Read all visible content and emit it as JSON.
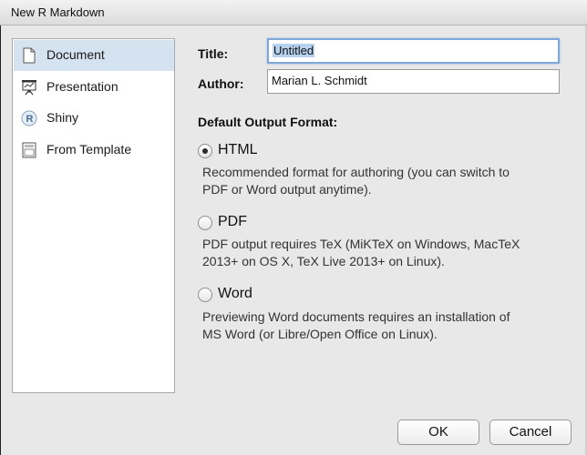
{
  "window": {
    "title": "New R Markdown"
  },
  "sidebar": {
    "items": [
      {
        "label": "Document",
        "icon": "document-icon",
        "selected": true
      },
      {
        "label": "Presentation",
        "icon": "presentation-icon",
        "selected": false
      },
      {
        "label": "Shiny",
        "icon": "shiny-r-icon",
        "selected": false
      },
      {
        "label": "From Template",
        "icon": "template-icon",
        "selected": false
      }
    ]
  },
  "form": {
    "title_label": "Title:",
    "title_value": "Untitled",
    "author_label": "Author:",
    "author_value": "Marian L. Schmidt",
    "output_heading": "Default Output Format:"
  },
  "formats": [
    {
      "label": "HTML",
      "checked": true,
      "description_line1": "Recommended format for authoring (you can switch to",
      "description_line2": "PDF or Word output anytime)."
    },
    {
      "label": "PDF",
      "checked": false,
      "description_line1": "PDF output requires TeX (MiKTeX on Windows, MacTeX",
      "description_line2": "2013+ on OS X, TeX Live 2013+ on Linux)."
    },
    {
      "label": "Word",
      "checked": false,
      "description_line1": "Previewing Word documents requires an installation of",
      "description_line2": "MS Word (or Libre/Open Office on Linux)."
    }
  ],
  "buttons": {
    "ok": "OK",
    "cancel": "Cancel"
  },
  "colors": {
    "selection": "#d5e3f1",
    "focus_ring": "#7da8d8"
  }
}
